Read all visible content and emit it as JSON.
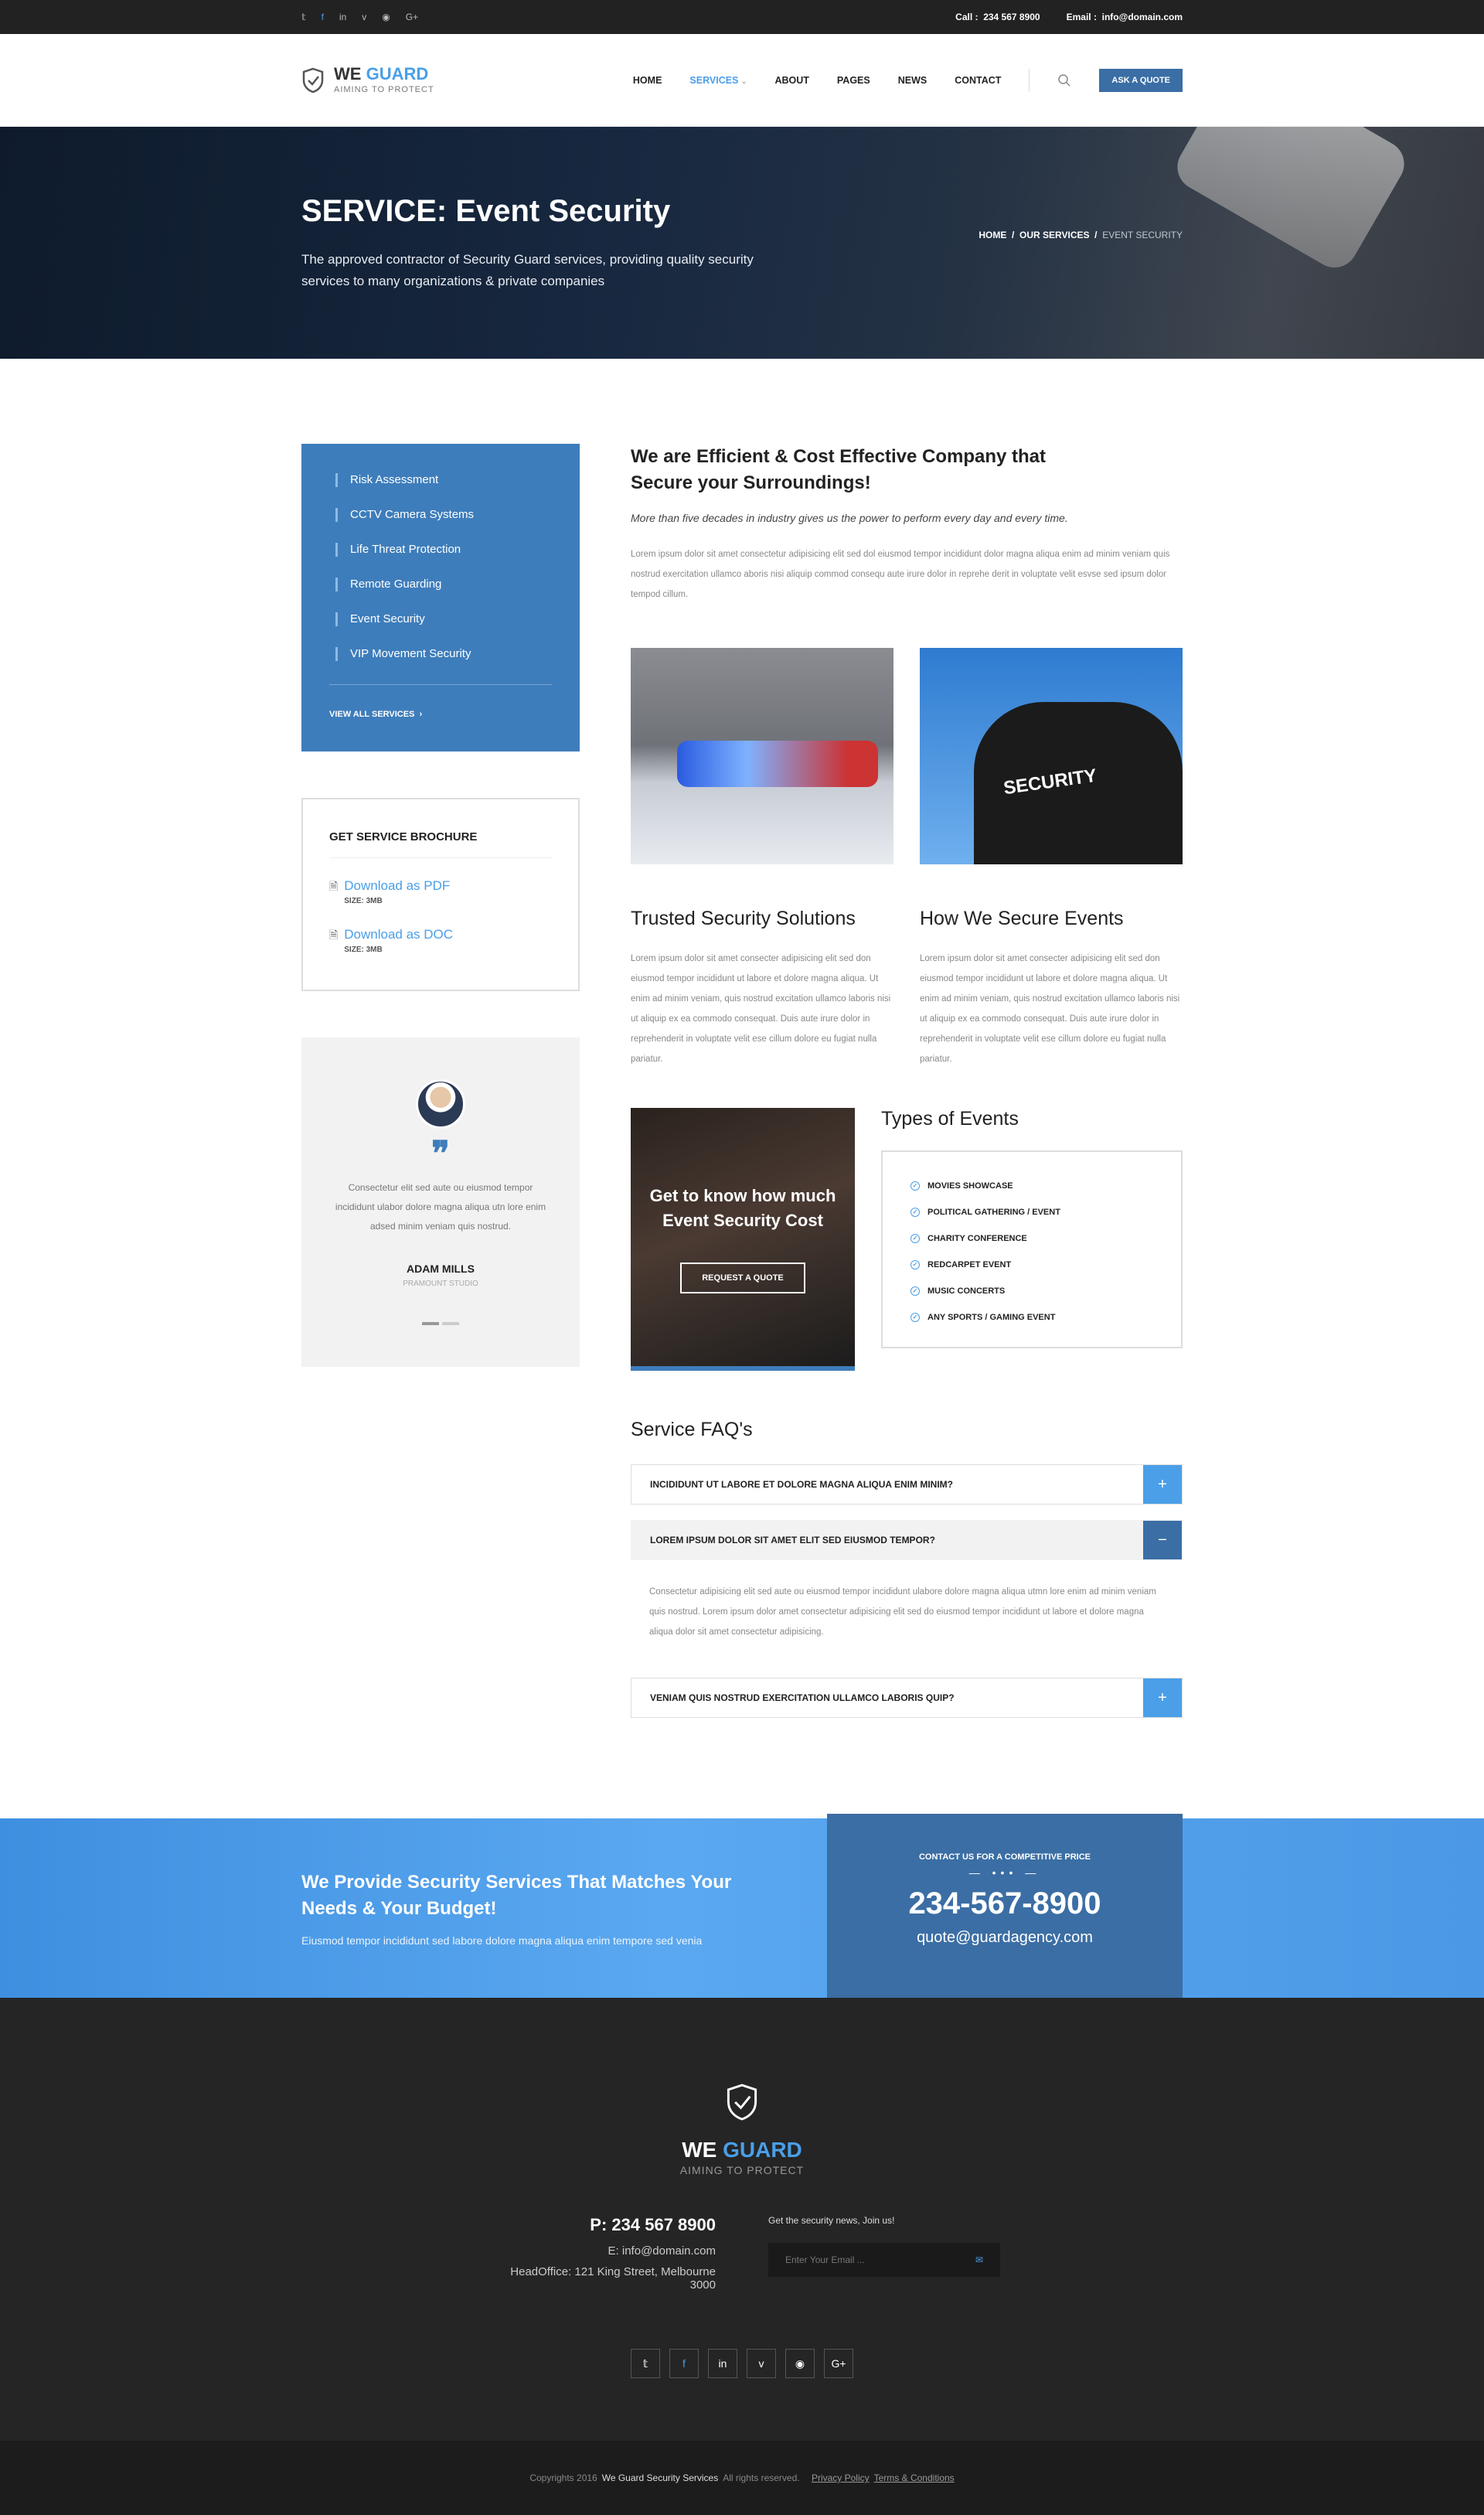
{
  "topbar": {
    "socials": [
      {
        "icon": "twitter-icon",
        "glyph": "𝕥"
      },
      {
        "icon": "facebook-icon",
        "glyph": "f"
      },
      {
        "icon": "linkedin-icon",
        "glyph": "in"
      },
      {
        "icon": "vimeo-icon",
        "glyph": "v"
      },
      {
        "icon": "rss-icon",
        "glyph": "◉"
      },
      {
        "icon": "google-plus-icon",
        "glyph": "G+"
      }
    ],
    "call_label": "Call :",
    "call_value": "234 567 8900",
    "email_label": "Email :",
    "email_value": "info@domain.com"
  },
  "header": {
    "logo_word1": "WE",
    "logo_word2": "GUARD",
    "logo_tagline": "AIMING TO PROTECT",
    "nav": [
      "HOME",
      "SERVICES",
      "ABOUT",
      "PAGES",
      "NEWS",
      "CONTACT"
    ],
    "quote_button": "ASK A QUOTE"
  },
  "hero": {
    "title": "SERVICE: Event Security",
    "subtitle": "The approved contractor of Security Guard services, providing quality security services to many organizations & private companies",
    "breadcrumb": [
      "HOME",
      "OUR SERVICES",
      "EVENT SECURITY"
    ]
  },
  "sidebar": {
    "services": [
      "Risk Assessment",
      "CCTV Camera Systems",
      "Life Threat Protection",
      "Remote Guarding",
      "Event Security",
      "VIP Movement Security"
    ],
    "view_all": "VIEW ALL SERVICES",
    "brochure_title": "GET SERVICE BROCHURE",
    "downloads": [
      {
        "label": "Download as PDF",
        "size": "SIZE: 3MB"
      },
      {
        "label": "Download as DOC",
        "size": "SIZE: 3MB"
      }
    ],
    "testimonial": {
      "text": "Consectetur elit sed aute ou eiusmod tempor incididunt ulabor dolore magna aliqua utn lore enim adsed minim veniam quis nostrud.",
      "name": "ADAM MILLS",
      "company": "PRAMOUNT STUDIO"
    }
  },
  "content": {
    "heading": "We are Efficient & Cost Effective Company that Secure your Surroundings!",
    "lead": "More than five decades in industry gives us the power to perform every day and every time.",
    "body": "Lorem ipsum dolor sit amet consectetur adipisicing elit sed dol eiusmod tempor incididunt dolor magna aliqua enim ad minim veniam quis nostrud exercitation ullamco aboris nisi aliquip commod consequ aute irure dolor in reprehe derit in voluptate velit esvse sed ipsum dolor tempod cillum.",
    "photo2_text": "SECURITY",
    "col1_title": "Trusted Security Solutions",
    "col1_text": "Lorem ipsum dolor sit amet consecter adipisicing elit sed don eiusmod tempor incididunt ut labore et dolore magna aliqua. Ut enim ad minim veniam, quis nostrud excitation ullamco laboris nisi ut aliquip ex ea commodo consequat. Duis aute irure dolor in reprehenderit in voluptate velit ese cillum dolore eu fugiat nulla pariatur.",
    "col2_title": "How We Secure Events",
    "col2_text": "Lorem ipsum dolor sit amet consecter adipisicing elit sed don eiusmod tempor incididunt ut labore et dolore magna aliqua. Ut enim ad minim veniam, quis nostrud excitation ullamco laboris nisi ut aliquip ex ea commodo consequat. Duis aute irure dolor in reprehenderit in voluptate velit ese cillum dolore eu fugiat nulla pariatur.",
    "promo_title": "Get to know how much Event Security Cost",
    "promo_button": "REQUEST A QUOTE",
    "events_title": "Types of Events",
    "events": [
      "MOVIES SHOWCASE",
      "POLITICAL GATHERING / EVENT",
      "CHARITY CONFERENCE",
      "REDCARPET EVENT",
      "MUSIC CONCERTS",
      "ANY SPORTS / GAMING EVENT"
    ],
    "faq_title": "Service FAQ's",
    "faq": [
      {
        "q": "INCIDIDUNT UT LABORE ET DOLORE MAGNA ALIQUA ENIM MINIM?",
        "toggle": "+"
      },
      {
        "q": "LOREM IPSUM DOLOR SIT AMET ELIT SED EIUSMOD TEMPOR?",
        "toggle": "−"
      },
      {
        "q": "VENIAM QUIS NOSTRUD EXERCITATION ULLAMCO LABORIS QUIP?",
        "toggle": "+"
      }
    ],
    "faq_answer": "Consectetur adipisicing elit sed aute ou eiusmod tempor incididunt ulabore dolore magna aliqua utmn lore enim ad minim veniam quis nostrud. Lorem ipsum dolor amet consectetur adipisicing elit sed do eiusmod tempor incididunt ut labore et dolore magna aliqua dolor sit amet consectetur adipisicing."
  },
  "cta": {
    "title": "We Provide Security Services That Matches Your Needs & Your Budget!",
    "text": "Eiusmod tempor incididunt sed labore dolore magna aliqua enim tempore sed venia",
    "box_label": "CONTACT US FOR A COMPETITIVE PRICE",
    "phone": "234-567-8900",
    "email": "quote@guardagency.com"
  },
  "footer": {
    "logo_word1": "WE",
    "logo_word2": "GUARD",
    "tagline": "AIMING TO PROTECT",
    "phone": "P: 234 567 8900",
    "email": "E: info@domain.com",
    "address": "HeadOffice: 121 King Street, Melbourne 3000",
    "newsletter_label": "Get the security news, Join us!",
    "newsletter_placeholder": "Enter Your Email ...",
    "copyright": "Copyrights 2016",
    "brand": "We Guard Security Services",
    "rights": "All rights reserved.",
    "privacy": "Privacy Policy",
    "terms": "Terms & Conditions"
  },
  "colors": {
    "accent": "#4a9fe8",
    "brand_dark": "#3a6ea5",
    "dark": "#222222"
  }
}
